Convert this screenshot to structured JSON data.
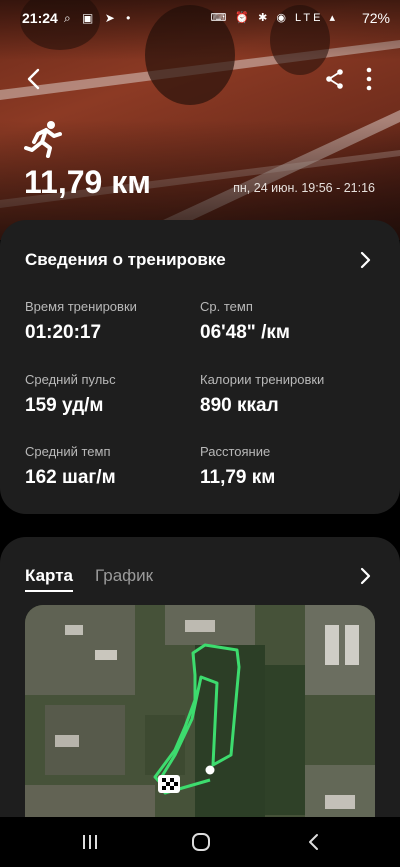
{
  "status_bar": {
    "time": "21:24",
    "battery": "72%"
  },
  "hero": {
    "distance": "11,79 км",
    "date_range": "пн, 24 июн. 19:56 - 21:16"
  },
  "summary": {
    "title": "Сведения о тренировке",
    "metrics": [
      {
        "label": "Время тренировки",
        "value": "01:20:17"
      },
      {
        "label": "Ср. темп",
        "value": "06'48\" /км"
      },
      {
        "label": "Средний пульс",
        "value": "159 уд/м"
      },
      {
        "label": "Калории тренировки",
        "value": "890 ккал"
      },
      {
        "label": "Средний темп",
        "value": "162 шаг/м"
      },
      {
        "label": "Расстояние",
        "value": "11,79 км"
      }
    ]
  },
  "map_card": {
    "tabs": [
      "Карта",
      "График"
    ],
    "active_tab": "Карта"
  },
  "colors": {
    "card_bg": "#1e1e1e",
    "route": "#3ddc6e",
    "hero_track": "#8c3a24"
  }
}
